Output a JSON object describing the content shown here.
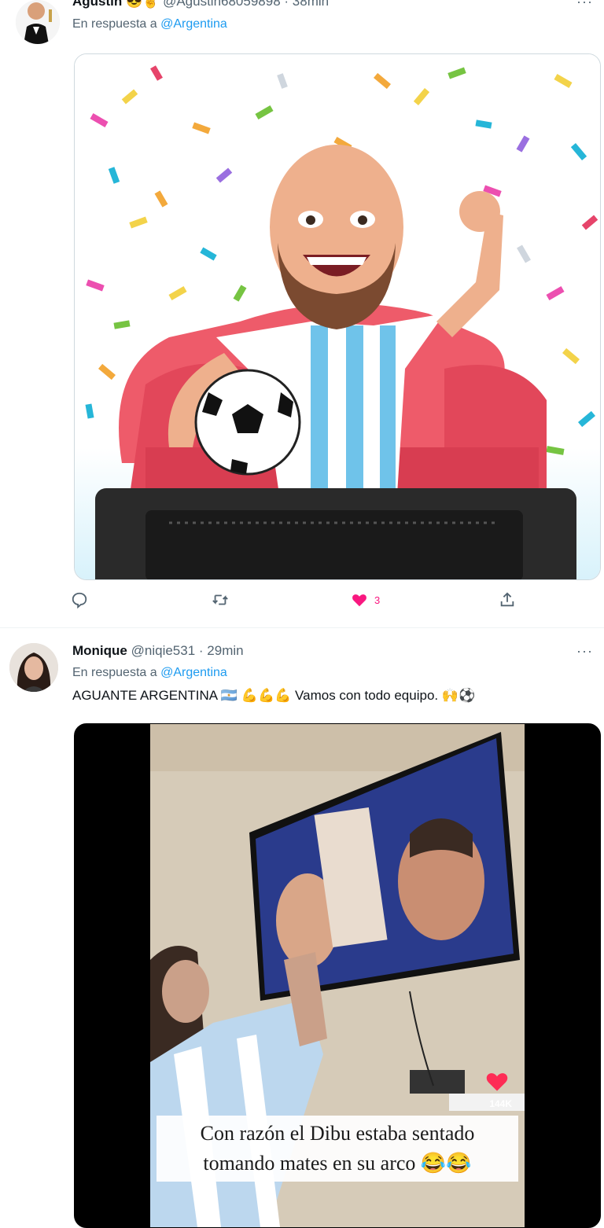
{
  "tweets": [
    {
      "name": "Agustín 😎✌",
      "handle": "@Agustin68059898",
      "time": "· 38min",
      "reply_prefix": "En respuesta a",
      "reply_to": "@Argentina",
      "more": "···",
      "likes": "3"
    },
    {
      "name": "Monique",
      "handle": "@niqie531",
      "time": "· 29min",
      "reply_prefix": "En respuesta a",
      "reply_to": "@Argentina",
      "more": "···",
      "text": "AGUANTE ARGENTINA 🇦🇷 💪💪💪 Vamos con todo equipo. 🙌⚽",
      "video": {
        "badge": "144K",
        "caption_line1": "Con razón el Dibu estaba sentado",
        "caption_line2": "tomando mates en su arco 😂😂"
      }
    }
  ],
  "icons": {
    "reply": "reply-icon",
    "retweet": "retweet-icon",
    "like": "heart-icon",
    "share": "share-icon"
  },
  "colors": {
    "like": "#f91880",
    "link": "#1d9bf0",
    "muted": "#536471"
  }
}
